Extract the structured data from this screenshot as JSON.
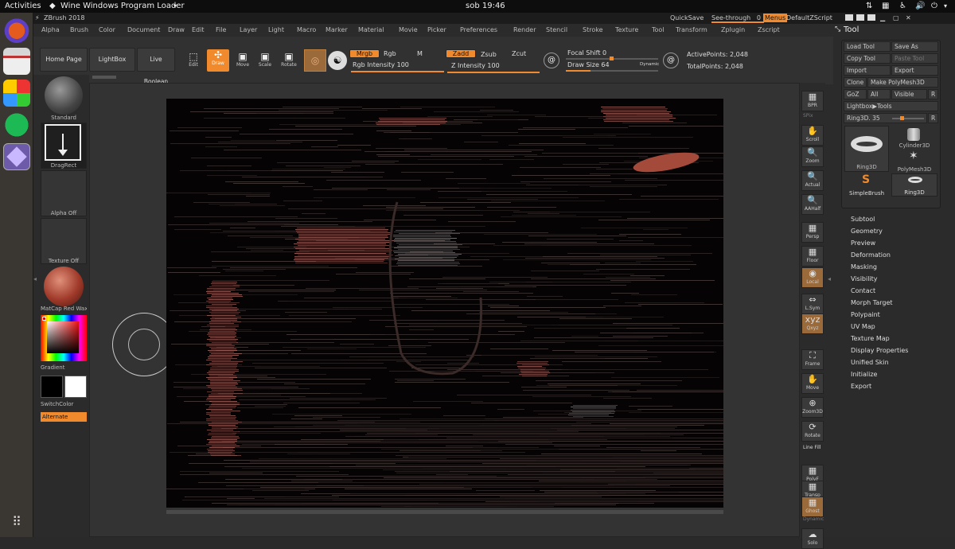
{
  "system_bar": {
    "activities": "Activities",
    "app_name": "Wine Windows Program Loader",
    "clock": "sob 19:46"
  },
  "title_bar": {
    "app_title": "ZBrush 2018",
    "quicksave": "QuickSave",
    "see_through_label": "See-through",
    "see_through_value": "0",
    "menus": "Menus",
    "default_zscript": "DefaultZScript"
  },
  "menu": [
    "Alpha",
    "Brush",
    "Color",
    "Document",
    "Draw",
    "Edit",
    "File",
    "Layer",
    "Light",
    "Macro",
    "Marker",
    "Material",
    "Movie",
    "Picker",
    "Preferences",
    "Render",
    "Stencil",
    "Stroke",
    "Texture",
    "Tool",
    "Transform",
    "Zplugin",
    "Zscript"
  ],
  "shelf": {
    "home_page": "Home Page",
    "lightbox": "LightBox",
    "live_boolean": "Live Boolean",
    "edit": "Edit",
    "draw": "Draw",
    "move": "Move",
    "scale": "Scale",
    "rotate": "Rotate",
    "mrgb": "Mrgb",
    "rgb": "Rgb",
    "m": "M",
    "zadd": "Zadd",
    "zsub": "Zsub",
    "zcut": "Zcut",
    "rgb_intensity_label": "Rgb Intensity",
    "rgb_intensity_value": "100",
    "z_intensity_label": "Z Intensity",
    "z_intensity_value": "100",
    "focal_shift_label": "Focal Shift",
    "focal_shift_value": "0",
    "draw_size_label": "Draw Size",
    "draw_size_value": "64",
    "dynamic": "Dynamic",
    "active_points_label": "ActivePoints:",
    "active_points_value": "2,048",
    "total_points_label": "TotalPoints:",
    "total_points_value": "2,048"
  },
  "left_shelf": {
    "brush": "Standard",
    "stroke": "DragRect",
    "alpha": "Alpha Off",
    "texture": "Texture Off",
    "material": "MatCap Red Wax",
    "gradient": "Gradient",
    "switch_color": "SwitchColor",
    "alternate": "Alternate"
  },
  "right_shelf": [
    "BPR",
    "SPix",
    "Scroll",
    "Zoom",
    "Actual",
    "AAHalf",
    "Persp",
    "Floor",
    "Local",
    "L.Sym",
    "Qxyz",
    "Frame",
    "Move",
    "Zoom3D",
    "Rotate",
    "Line Fill",
    "PolyF",
    "Transp",
    "Ghost",
    "Dynamic",
    "Solo"
  ],
  "tool_panel": {
    "title": "Tool",
    "load_tool": "Load Tool",
    "save_as": "Save As",
    "copy_tool": "Copy Tool",
    "paste_tool": "Paste Tool",
    "import": "Import",
    "export": "Export",
    "clone": "Clone",
    "make_polymesh": "Make PolyMesh3D",
    "goz": "GoZ",
    "all": "All",
    "visible": "Visible",
    "r": "R",
    "lightbox_tools": "Lightbox▶Tools",
    "current_tool": "Ring3D.",
    "current_value": "35",
    "tools": [
      "Ring3D",
      "Cylinder3D",
      "PolyMesh3D",
      "SimpleBrush",
      "Ring3D"
    ],
    "sections": [
      "Subtool",
      "Geometry",
      "Preview",
      "Deformation",
      "Masking",
      "Visibility",
      "Contact",
      "Morph Target",
      "Polypaint",
      "UV Map",
      "Texture Map",
      "Display Properties",
      "Unified Skin",
      "Initialize",
      "Export"
    ]
  },
  "colors": {
    "accent": "#f08a2c",
    "background": "#2b2b2b",
    "canvas": "#050303",
    "mesh": "#c8786e"
  }
}
